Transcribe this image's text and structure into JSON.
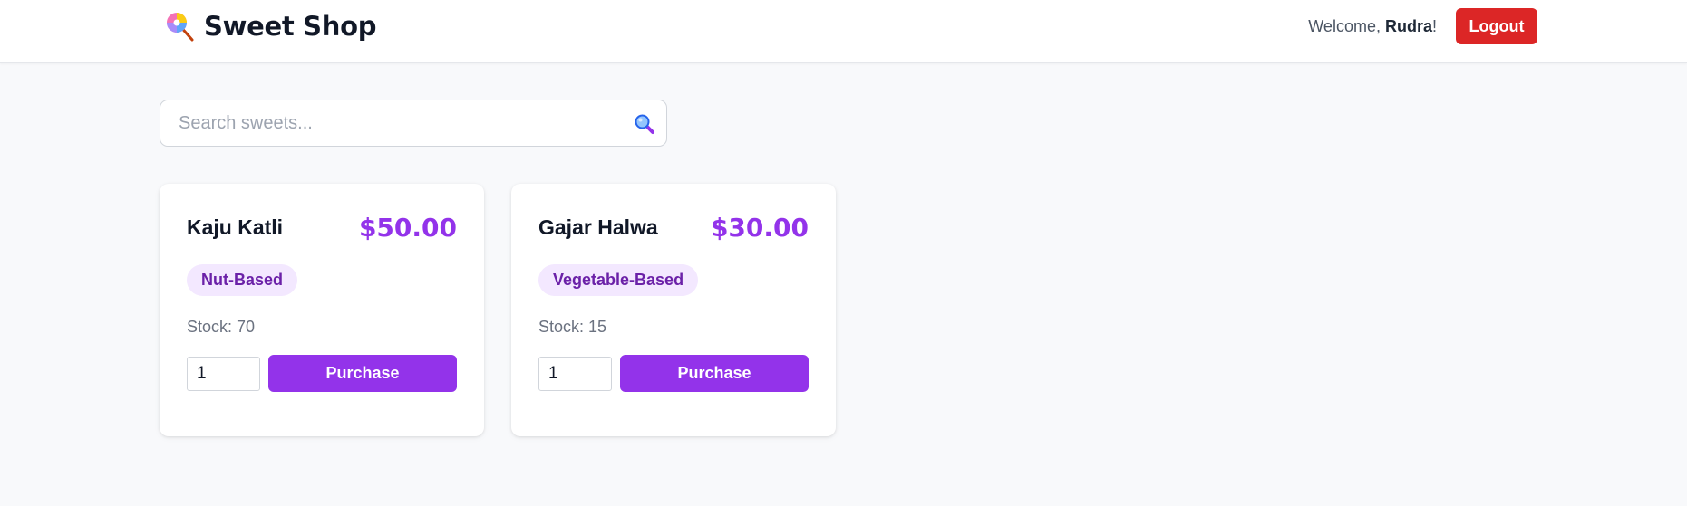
{
  "header": {
    "brand_icon": "lollipop-icon",
    "brand_title": "Sweet Shop",
    "welcome_prefix": "Welcome, ",
    "user_name": "Rudra",
    "welcome_suffix": "!",
    "logout_label": "Logout"
  },
  "search": {
    "placeholder": "Search sweets...",
    "value": "",
    "icon": "magnifier-icon"
  },
  "sweets": [
    {
      "name": "Kaju Katli",
      "price": "$50.00",
      "category": "Nut-Based",
      "stock_text": "Stock: 70",
      "quantity": "1",
      "purchase_label": "Purchase"
    },
    {
      "name": "Gajar Halwa",
      "price": "$30.00",
      "category": "Vegetable-Based",
      "stock_text": "Stock: 15",
      "quantity": "1",
      "purchase_label": "Purchase"
    }
  ],
  "colors": {
    "accent": "#9333ea",
    "badge_bg": "#f3e8ff",
    "badge_text": "#6b21a8",
    "logout": "#dc2626",
    "background": "#f8f9fb"
  }
}
